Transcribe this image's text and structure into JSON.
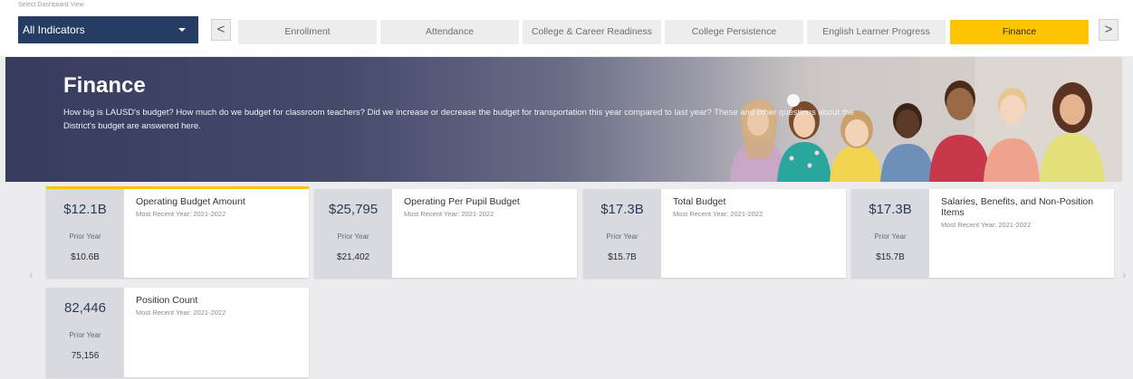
{
  "header": {
    "view_label": "Select Dashboard View",
    "dropdown_value": "All Indicators",
    "prev_label": "<",
    "next_label": ">",
    "tabs": [
      {
        "label": "Enrollment"
      },
      {
        "label": "Attendance"
      },
      {
        "label": "College & Career Readiness"
      },
      {
        "label": "College Persistence"
      },
      {
        "label": "English Learner Progress"
      },
      {
        "label": "Finance"
      }
    ],
    "active_tab": "Finance"
  },
  "hero": {
    "title": "Finance",
    "description": "How big is LAUSD's budget? How much do we budget for classroom teachers? Did we increase or decrease the budget for transportation this year compared to last year? These and other questions about the District's budget are answered here."
  },
  "carousel": {
    "left_arrow": "‹",
    "right_arrow": "›"
  },
  "cards": [
    {
      "value": "$12.1B",
      "prior_label": "Prior Year",
      "prior_value": "$10.6B",
      "title": "Operating Budget Amount",
      "subtitle": "Most Recent Year: 2021-2022"
    },
    {
      "value": "$25,795",
      "prior_label": "Prior Year",
      "prior_value": "$21,402",
      "title": "Operating Per Pupil Budget",
      "subtitle": "Most Recent Year: 2021-2022"
    },
    {
      "value": "$17.3B",
      "prior_label": "Prior Year",
      "prior_value": "$15.7B",
      "title": "Total Budget",
      "subtitle": "Most Recent Year: 2021-2022"
    },
    {
      "value": "$17.3B",
      "prior_label": "Prior Year",
      "prior_value": "$15.7B",
      "title": "Salaries, Benefits, and Non-Position Items",
      "subtitle": "Most Recent Year: 2021-2022"
    },
    {
      "value": "82,446",
      "prior_label": "Prior Year",
      "prior_value": "75,156",
      "title": "Position Count",
      "subtitle": "Most Recent Year: 2021-2022"
    }
  ],
  "colors": {
    "accent": "#ffc400",
    "dropdown_bg": "#253d62",
    "stat_panel": "#d9dadf"
  }
}
